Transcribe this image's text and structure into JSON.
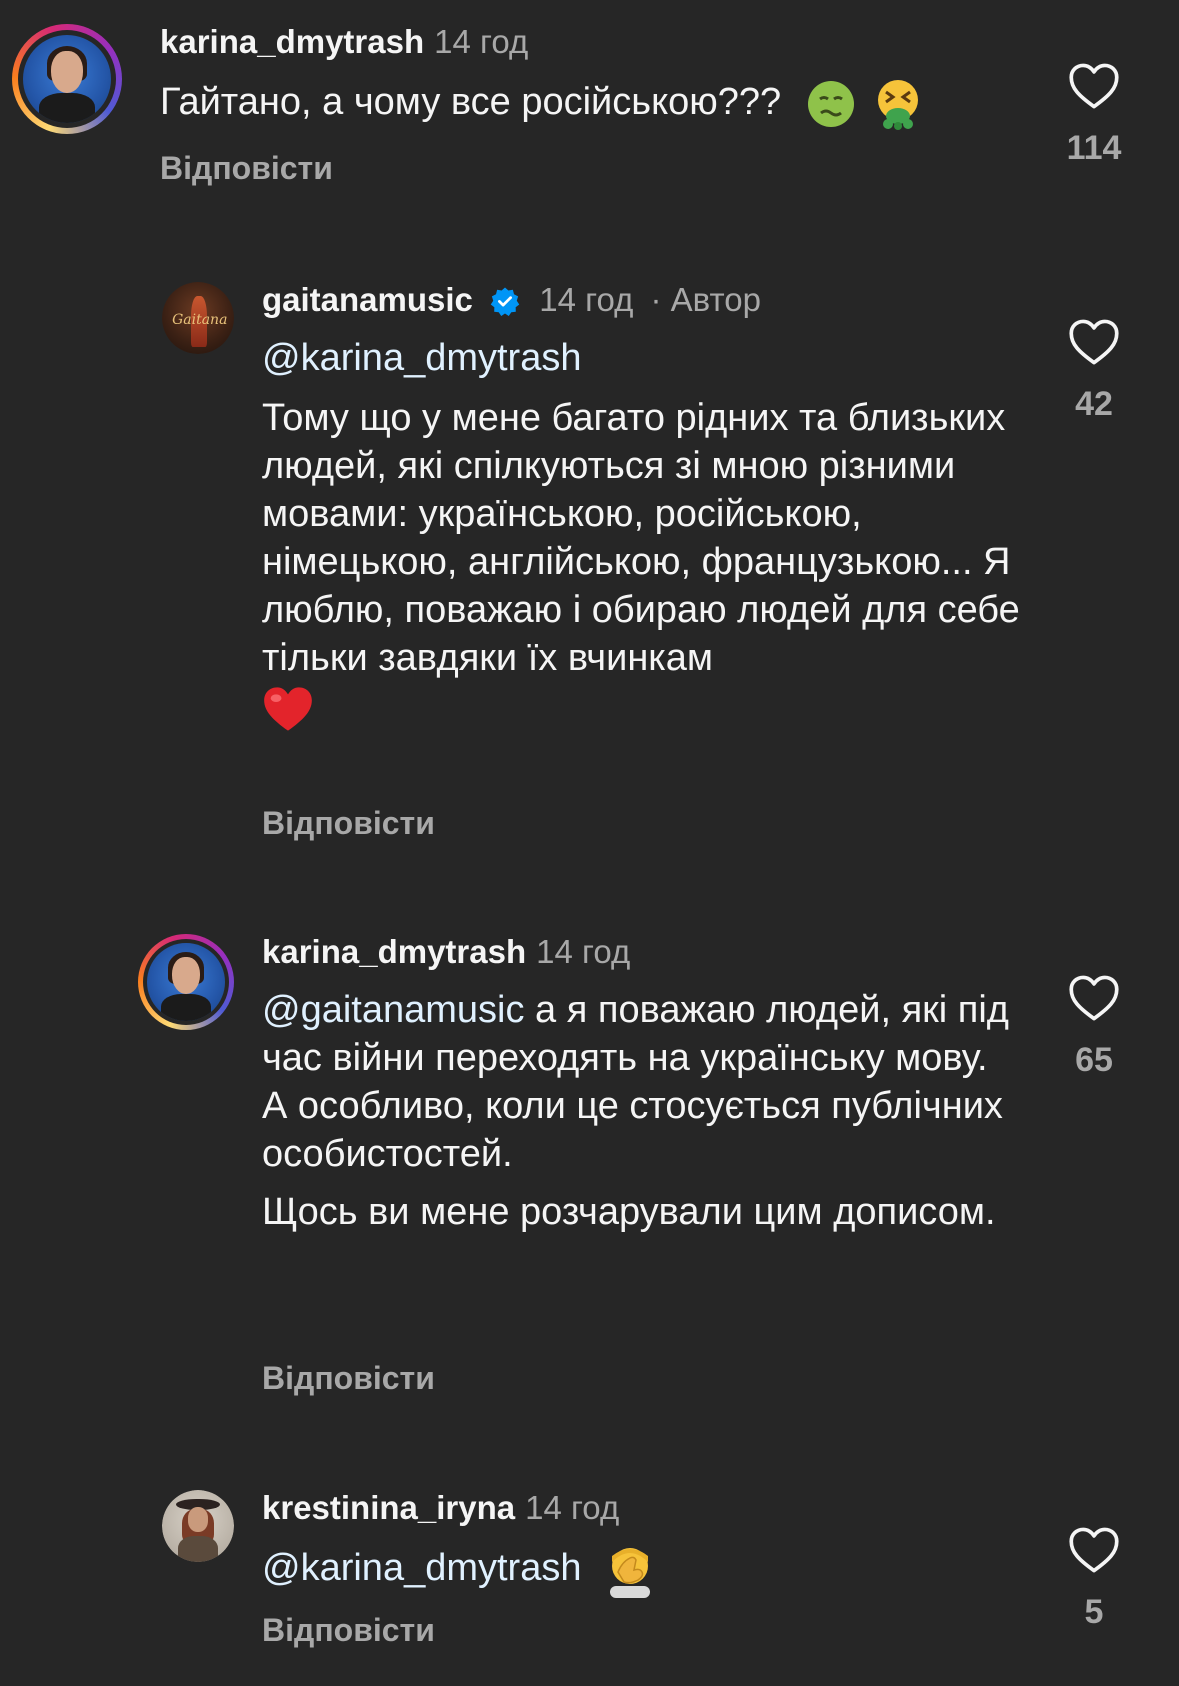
{
  "comments": [
    {
      "username": "karina_dmytrash",
      "time": "14 год",
      "text": "Гайтано, а чому все російською???",
      "emoji": [
        "nauseated-face",
        "face-vomiting"
      ],
      "reply_label": "Відповісти",
      "likes": "114"
    },
    {
      "username": "gaitanamusic",
      "verified": true,
      "time": "14 год",
      "author_tag": "· Автор",
      "mention": "@karina_dmytrash",
      "text": "Тому що у мене багато рідних та близьких людей, які спілкуються зі мною різними мовами: українською, російською, німецькою, англійською, французькою... Я люблю, поважаю і обираю людей для себе тільки завдяки їх вчинкам",
      "emoji": [
        "red-heart"
      ],
      "reply_label": "Відповісти",
      "likes": "42"
    },
    {
      "username": "karina_dmytrash",
      "time": "14 год",
      "mention": "@gaitanamusic",
      "text": "а я поважаю людей, які під час війни переходять на українську мову. А особливо, коли це стосується публічних особистостей.",
      "text2": "Щось ви мене розчарували цим дописом.",
      "reply_label": "Відповісти",
      "likes": "65"
    },
    {
      "username": "krestinina_iryna",
      "time": "14 год",
      "mention": "@karina_dmytrash",
      "emoji": [
        "face-palm"
      ],
      "reply_label": "Відповісти",
      "likes": "5"
    }
  ],
  "colors": {
    "background": "#262626",
    "primary_text": "#f5f5f5",
    "secondary_text": "#a8a8a8",
    "mention": "#e0f1ff",
    "verified_badge": "#0095f6"
  },
  "icons": {
    "like": "heart-outline-icon",
    "verified": "verified-badge-icon"
  }
}
